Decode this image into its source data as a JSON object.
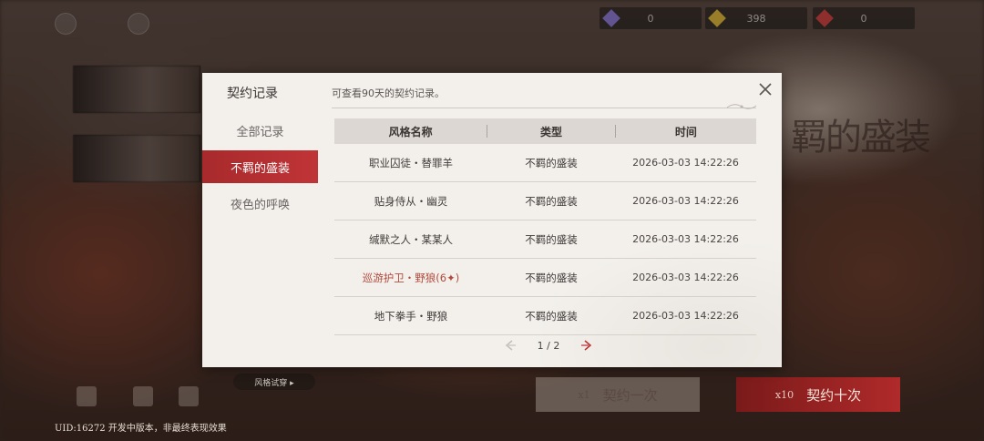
{
  "background": {
    "currencies": [
      {
        "value": "0",
        "icon": "star-shard-icon",
        "color": "#8a7ad8"
      },
      {
        "value": "398",
        "icon": "gold-ticket-icon",
        "color": "#e0b83a"
      },
      {
        "value": "0",
        "icon": "red-ticket-icon",
        "color": "#d04040"
      }
    ],
    "uid_text": "UID:16272  开发中版本，非最终表现效果",
    "pill_label": "风格试穿 ▸",
    "summon_one": {
      "count": "x1",
      "label": "契约一次"
    },
    "summon_ten": {
      "count": "x10",
      "label": "契约十次"
    },
    "right_title": "羁的盛装"
  },
  "modal": {
    "title": "契约记录",
    "subtitle": "可查看90天的契约记录。",
    "sidebar": [
      {
        "label": "全部记录",
        "active": false
      },
      {
        "label": "不羁的盛装",
        "active": true
      },
      {
        "label": "夜色的呼唤",
        "active": false
      }
    ],
    "table": {
      "headers": [
        "风格名称",
        "类型",
        "时间"
      ],
      "rows": [
        {
          "name": "职业囚徒・替罪羊",
          "type": "不羁的盛装",
          "time": "2026-03-03 14:22:26"
        },
        {
          "name": "贴身侍从・幽灵",
          "type": "不羁的盛装",
          "time": "2026-03-03 14:22:26"
        },
        {
          "name": "缄默之人・某某人",
          "type": "不羁的盛装",
          "time": "2026-03-03 14:22:26"
        },
        {
          "name": "巡游护卫・野狼(6✦)",
          "type": "不羁的盛装",
          "time": "2026-03-03 14:22:26",
          "highlight": true
        },
        {
          "name": "地下拳手・野狼",
          "type": "不羁的盛装",
          "time": "2026-03-03 14:22:26"
        }
      ]
    },
    "pager": {
      "current": "1",
      "total": "2",
      "text": "1 / 2"
    },
    "colors": {
      "accent": "#b8302f",
      "highlight_text": "#b24a3c",
      "panel": "#f3f0ec"
    }
  }
}
